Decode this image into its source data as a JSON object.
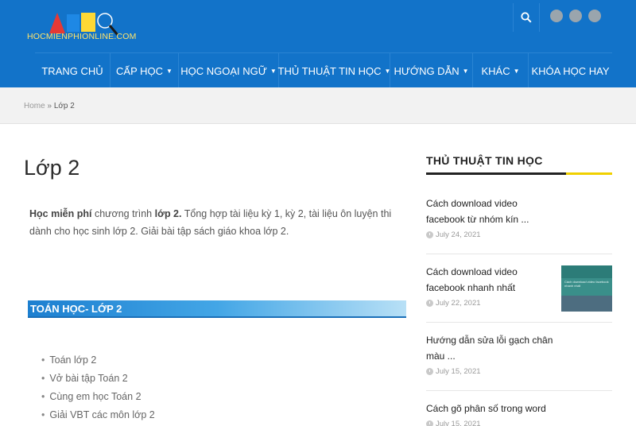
{
  "site": {
    "logo_text": "HOCMIENPHIONLINE.COM",
    "colors": {
      "header_bg": "#1273c9",
      "accent_yellow": "#f0d000",
      "logo_red": "#e53935",
      "logo_blue": "#1e88e5",
      "logo_yellow": "#fdd835"
    }
  },
  "header": {
    "search_icon": "search-icon",
    "social_icons": [
      "social-icon-1",
      "social-icon-2",
      "social-icon-3"
    ]
  },
  "nav": {
    "items": [
      {
        "label": "TRANG CHỦ",
        "has_dropdown": false
      },
      {
        "label": "CẤP HỌC",
        "has_dropdown": true
      },
      {
        "label": "HỌC NGOẠI NGỮ",
        "has_dropdown": true
      },
      {
        "label": "THỦ THUẬT TIN HỌC",
        "has_dropdown": true
      },
      {
        "label": "HƯỚNG DẪN",
        "has_dropdown": true
      },
      {
        "label": "KHÁC",
        "has_dropdown": true
      },
      {
        "label": "KHÓA HỌC HAY",
        "has_dropdown": false
      }
    ]
  },
  "breadcrumb": {
    "home": "Home",
    "separator": "»",
    "current": "Lớp 2"
  },
  "main": {
    "title": "Lớp 2",
    "intro": {
      "bold1": "Học miễn phí",
      "text1": " chương trình ",
      "bold2": "lớp 2.",
      "text2": " Tổng hợp tài liệu kỳ 1, kỳ 2, tài liệu ôn luyện thi dành cho học sinh lớp 2. Giải bài tập sách giáo khoa lớp 2."
    },
    "section_title": "TOÁN HỌC- LỚP 2",
    "list": [
      "Toán lớp 2",
      "Vở bài tập Toán 2",
      "Cùng em học Toán 2",
      "Giải VBT các môn lớp 2"
    ]
  },
  "sidebar": {
    "title": "THỦ THUẬT TIN HỌC",
    "posts": [
      {
        "title": "Cách download video facebook từ nhóm kín ...",
        "date": "July 24, 2021"
      },
      {
        "title": "Cách download video facebook nhanh nhất",
        "date": "July 22, 2021",
        "thumb_text": "Cách download video facebook nhanh nhất"
      },
      {
        "title": "Hướng dẫn sửa lỗi gạch chân màu ...",
        "date": "July 15, 2021"
      },
      {
        "title": "Cách gõ phân số trong word",
        "date": "July 15, 2021"
      }
    ]
  }
}
